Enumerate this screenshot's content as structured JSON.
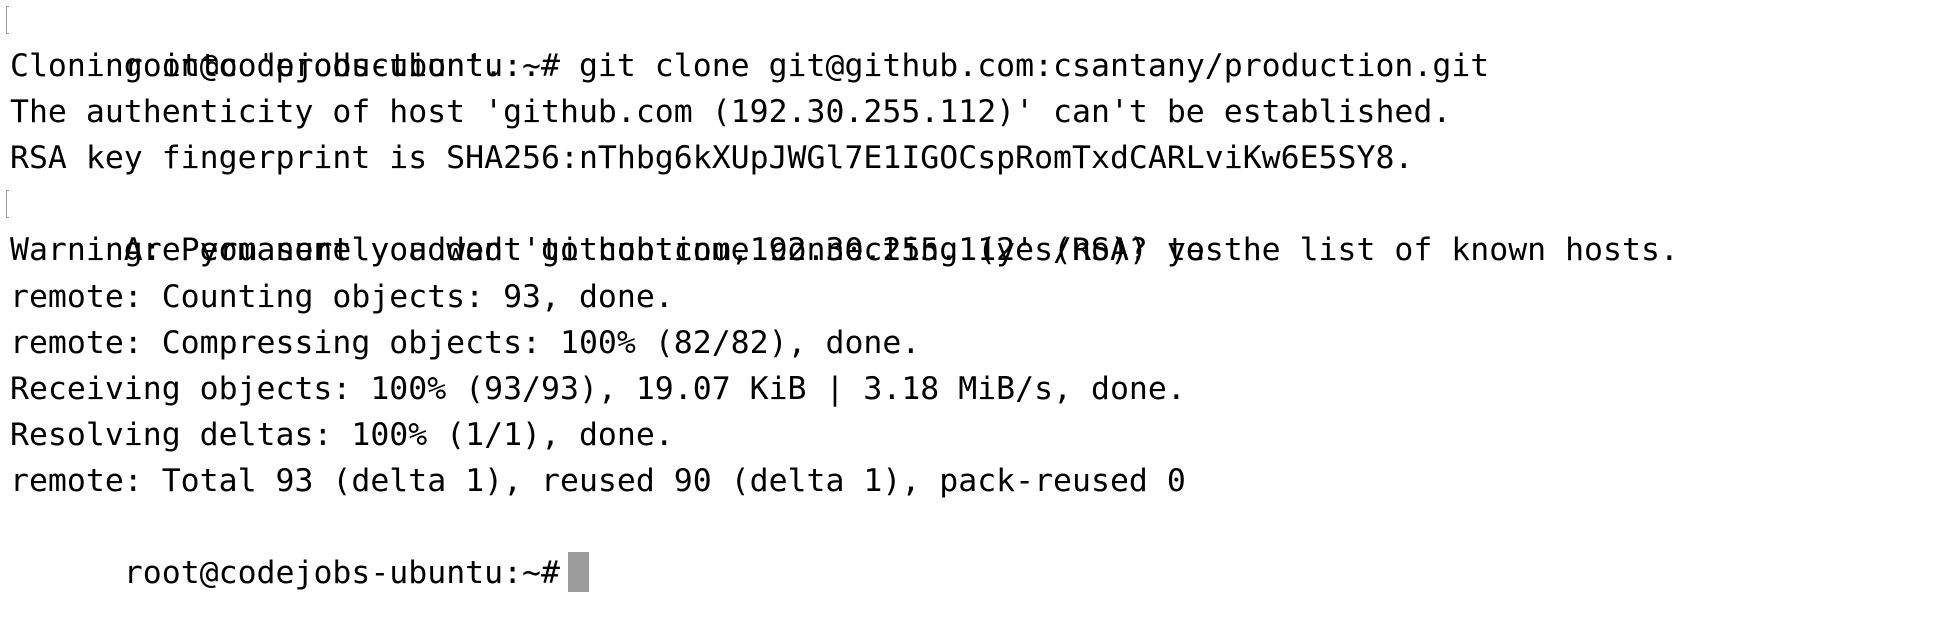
{
  "terminal": {
    "background": "#ffffff",
    "text_color": "#000000",
    "cursor_color": "#9b9b9b",
    "lines": [
      "root@codejobs-ubuntu:~# git clone git@github.com:csantany/production.git",
      "Cloning into 'production'...",
      "The authenticity of host 'github.com (192.30.255.112)' can't be established.",
      "RSA key fingerprint is SHA256:nThbg6kXUpJWGl7E1IGOCspRomTxdCARLviKw6E5SY8.",
      "Are you sure you want to continue connecting (yes/no)? yes",
      "Warning: Permanently added 'github.com,192.30.255.112' (RSA) to the list of known hosts.",
      "remote: Counting objects: 93, done.",
      "remote: Compressing objects: 100% (82/82), done.",
      "Receiving objects: 100% (93/93), 19.07 KiB | 3.18 MiB/s, done.",
      "Resolving deltas: 100% (1/1), done.",
      "remote: Total 93 (delta 1), reused 90 (delta 1), pack-reused 0"
    ],
    "prompt": "root@codejobs-ubuntu:~#"
  }
}
